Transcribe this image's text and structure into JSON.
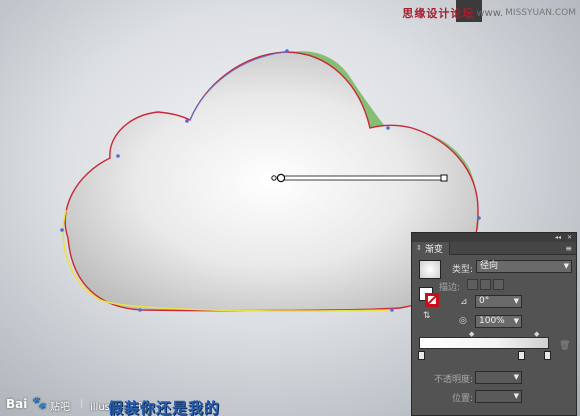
{
  "watermark": {
    "site_name": "思缘设计论坛",
    "separator": "www.",
    "url": "MISSYUAN.COM"
  },
  "bottom_watermark": {
    "baidu": "Bai",
    "tieba": "贴吧",
    "divider": "|",
    "bar_name": "illustrator吧",
    "subtitle": "假装你还是我的"
  },
  "gradient_panel": {
    "collapse_label": "◂◂",
    "close_label": "✕",
    "tab_label": "渐变",
    "menu_icon": "≡",
    "type_label": "类型:",
    "type_value": "径向",
    "stroke_label": "描边:",
    "angle_value": "0°",
    "aspect_value": "100%",
    "opacity_label": "不透明度:",
    "position_label": "位置:",
    "gradient_colors": [
      "#ffffff",
      "#f3f3f3",
      "#cfcfcf"
    ]
  },
  "colors": {
    "cloud_fill_center": "#ffffff",
    "cloud_fill_edge": "#b8b8b8",
    "green_shape": "#7fb86f",
    "red_stroke": "#c8283a",
    "yellow_stroke": "#e6e24a",
    "blue_stroke": "#5c6fd0"
  }
}
